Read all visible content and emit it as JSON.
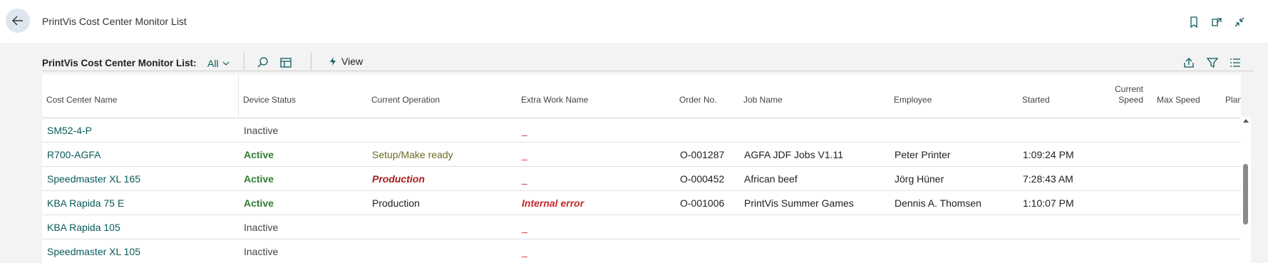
{
  "header": {
    "title": "PrintVis Cost Center Monitor List"
  },
  "actionbar": {
    "caption": "PrintVis Cost Center Monitor List:",
    "filter_value": "All",
    "view_label": "View"
  },
  "columns": {
    "cost_center_name": "Cost Center Name",
    "device_status": "Device Status",
    "current_operation": "Current Operation",
    "extra_work_name": "Extra Work Name",
    "order_no": "Order No.",
    "job_name": "Job Name",
    "employee": "Employee",
    "started": "Started",
    "current_speed_line1": "Current",
    "current_speed_line2": "Speed",
    "max_speed": "Max Speed",
    "planned": "Planne"
  },
  "rows": [
    {
      "name": "SM52-4-P",
      "status": "Inactive",
      "operation": "",
      "extra": "_",
      "order": "",
      "job": "",
      "employee": "",
      "started": ""
    },
    {
      "name": "R700-AGFA",
      "status": "Active",
      "operation": "Setup/Make ready",
      "extra": "_",
      "order": "O-001287",
      "job": "AGFA JDF Jobs V1.11",
      "employee": "Peter Printer",
      "started": "1:09:24 PM"
    },
    {
      "name": "Speedmaster XL 165",
      "status": "Active",
      "operation": "Production",
      "extra": "_",
      "order": "O-000452",
      "job": "African beef",
      "employee": "Jörg Hüner",
      "started": "7:28:43 AM"
    },
    {
      "name": "KBA Rapida 75 E",
      "status": "Active",
      "operation": "Production",
      "extra": "Internal error",
      "order": "O-001006",
      "job": "PrintVis Summer Games",
      "employee": "Dennis A. Thomsen",
      "started": "1:10:07 PM"
    },
    {
      "name": "KBA Rapida 105",
      "status": "Inactive",
      "operation": "",
      "extra": "_",
      "order": "",
      "job": "",
      "employee": "",
      "started": ""
    },
    {
      "name": "Speedmaster XL 105",
      "status": "Inactive",
      "operation": "",
      "extra": "_",
      "order": "",
      "job": "",
      "employee": "",
      "started": ""
    }
  ],
  "colors": {
    "link": "#0b5a5a",
    "active": "#2e7d32",
    "error": "#c62828"
  }
}
